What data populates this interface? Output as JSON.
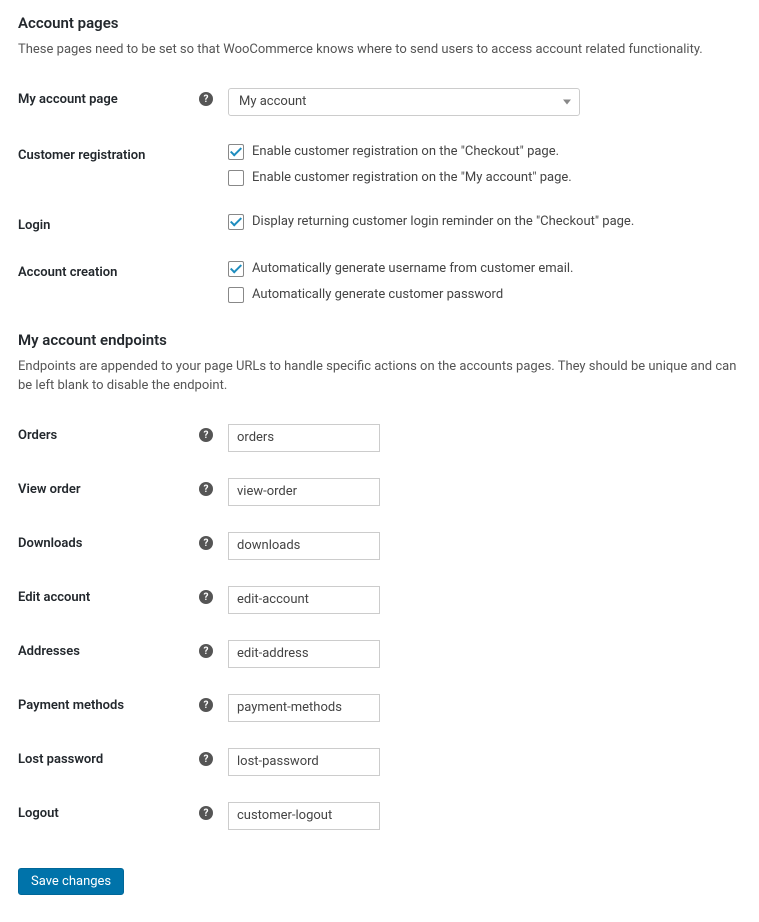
{
  "section1": {
    "heading": "Account pages",
    "desc": "These pages need to be set so that WooCommerce knows where to send users to access account related functionality."
  },
  "myAccountPage": {
    "label": "My account page",
    "value": "My account"
  },
  "customerRegistration": {
    "label": "Customer registration",
    "opt1": {
      "checked": true,
      "label": "Enable customer registration on the \"Checkout\" page."
    },
    "opt2": {
      "checked": false,
      "label": "Enable customer registration on the \"My account\" page."
    }
  },
  "login": {
    "label": "Login",
    "opt1": {
      "checked": true,
      "label": "Display returning customer login reminder on the \"Checkout\" page."
    }
  },
  "accountCreation": {
    "label": "Account creation",
    "opt1": {
      "checked": true,
      "label": "Automatically generate username from customer email."
    },
    "opt2": {
      "checked": false,
      "label": "Automatically generate customer password"
    }
  },
  "section2": {
    "heading": "My account endpoints",
    "desc": "Endpoints are appended to your page URLs to handle specific actions on the accounts pages. They should be unique and can be left blank to disable the endpoint."
  },
  "endpoints": {
    "orders": {
      "label": "Orders",
      "value": "orders"
    },
    "viewOrder": {
      "label": "View order",
      "value": "view-order"
    },
    "downloads": {
      "label": "Downloads",
      "value": "downloads"
    },
    "editAccount": {
      "label": "Edit account",
      "value": "edit-account"
    },
    "addresses": {
      "label": "Addresses",
      "value": "edit-address"
    },
    "paymentMethods": {
      "label": "Payment methods",
      "value": "payment-methods"
    },
    "lostPassword": {
      "label": "Lost password",
      "value": "lost-password"
    },
    "logout": {
      "label": "Logout",
      "value": "customer-logout"
    }
  },
  "saveLabel": "Save changes",
  "helpGlyph": "?"
}
